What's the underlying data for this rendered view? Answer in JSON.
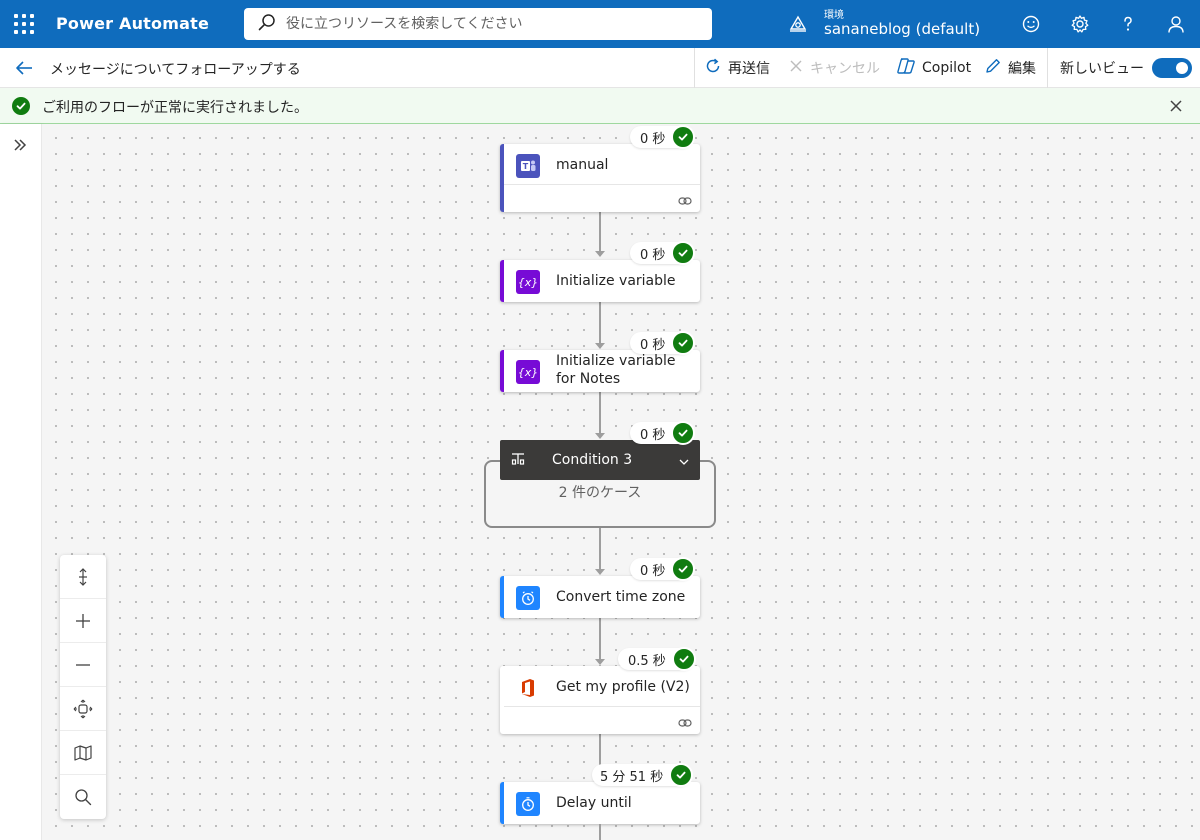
{
  "app": {
    "name": "Power Automate"
  },
  "search": {
    "placeholder": "役に立つリソースを検索してください"
  },
  "environment": {
    "label": "環境",
    "name": "sananeblog (default)"
  },
  "cmdbar": {
    "flow_title": "メッセージについてフォローアップする",
    "resubmit": "再送信",
    "cancel": "キャンセル",
    "copilot": "Copilot",
    "edit": "編集",
    "new_view": "新しいビュー"
  },
  "banner": {
    "message": "ご利用のフローが正常に実行されました。"
  },
  "colors": {
    "brand": "#0f6cbd",
    "success": "#107c10",
    "teams": "#4b53bc",
    "variable": "#770bd6",
    "datetime": "#1f85ff",
    "office": "#d83b01"
  },
  "steps": [
    {
      "title": "manual",
      "duration": "0 秒",
      "icon": "teams-icon"
    },
    {
      "title": "Initialize variable",
      "duration": "0 秒",
      "icon": "variable-icon"
    },
    {
      "title": "Initialize variable for Notes",
      "duration": "0 秒",
      "icon": "variable-icon"
    },
    {
      "title": "Condition 3",
      "duration": "0 秒",
      "icon": "condition-icon",
      "cases": "2 件のケース"
    },
    {
      "title": "Convert time zone",
      "duration": "0 秒",
      "icon": "clock-icon"
    },
    {
      "title": "Get my profile (V2)",
      "duration": "0.5 秒",
      "icon": "office-icon"
    },
    {
      "title": "Delay until",
      "duration": "5 分 51 秒",
      "icon": "clock-icon"
    }
  ],
  "zoom_controls": [
    "fit-height-icon",
    "zoom-in-icon",
    "zoom-out-icon",
    "fit-view-icon",
    "minimap-icon",
    "search-icon"
  ]
}
